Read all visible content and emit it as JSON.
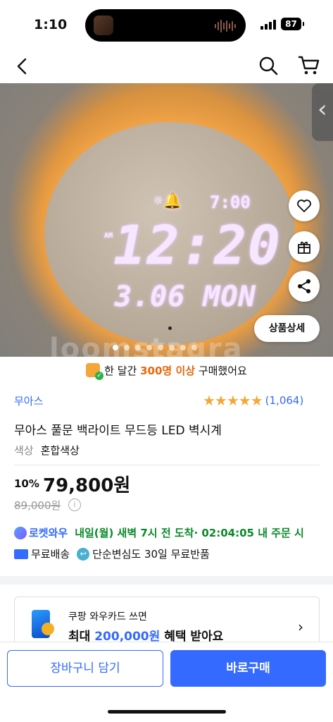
{
  "status_bar": {
    "time": "1:10",
    "battery": "87"
  },
  "nav": {
    "back": "back",
    "search": "search",
    "cart": "cart"
  },
  "hero": {
    "clock_alarm": "7:00",
    "clock_am": "AM",
    "clock_time": "12:20",
    "clock_date": "3.06 MON",
    "watermark": "loomstagra",
    "detail_button": "상품상세",
    "slide_count": 8,
    "active_slide": 1
  },
  "buyers_banner": {
    "prefix": "한 달간 ",
    "count": "300명 이상",
    "suffix": " 구매했어요"
  },
  "product": {
    "seller": "무아스",
    "rating_stars": 5,
    "review_count": "(1,064)",
    "title": "무아스 풀문 백라이트 무드등 LED 벽시계",
    "option_key": "색상",
    "option_value": "혼합색상",
    "discount": "10%",
    "price": "79,800원",
    "original_price": "89,000원"
  },
  "delivery": {
    "badge": "로켓와우",
    "arrival": "내일(월) 새벽 7시 전 도착",
    "countdown": " · 02:04:05 내 주문 시",
    "free_shipping": "무료배송",
    "returns": "단순변심도 30일 무료반품"
  },
  "card_promo": {
    "line1": "쿠팡 와우카드 쓰면",
    "line2_prefix": "최대 ",
    "line2_amount": "200,000원",
    "line2_suffix": " 혜택 받아요"
  },
  "bottom_bar": {
    "cart_button": "장바구니 담기",
    "buy_button": "바로구매"
  },
  "colors": {
    "accent": "#346aff",
    "highlight": "#e8660a",
    "rocket_green": "#0a8a2a",
    "star": "#f4a838"
  }
}
